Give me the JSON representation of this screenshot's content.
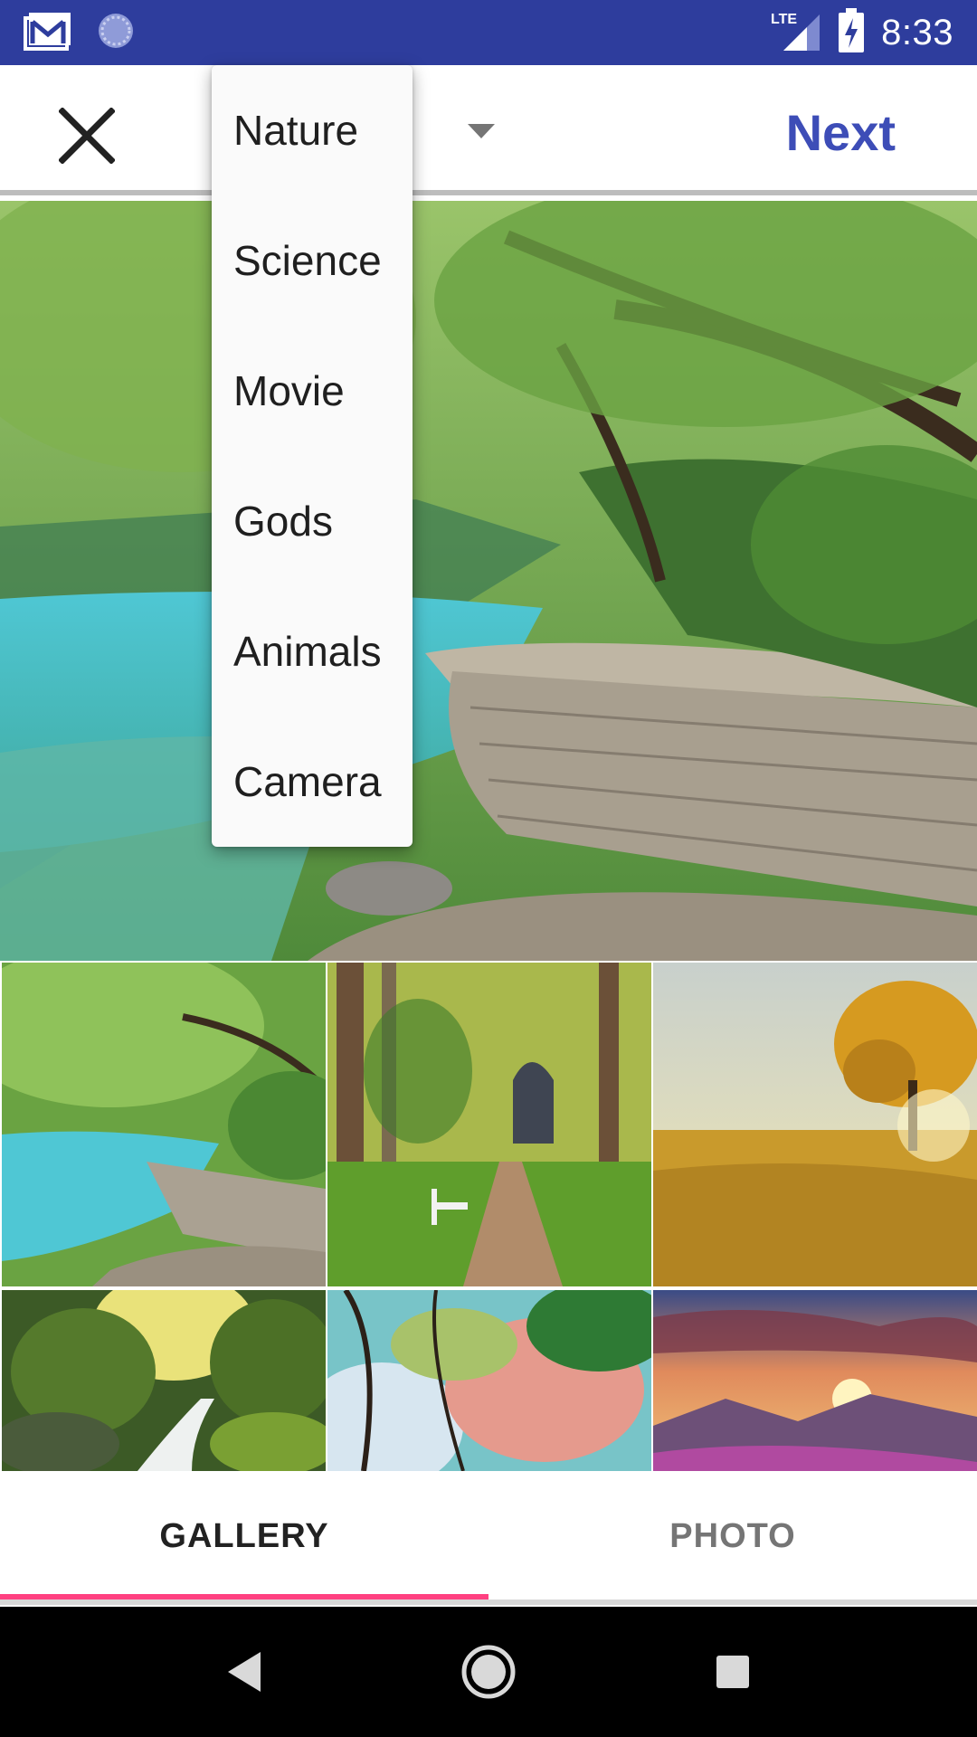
{
  "status_bar": {
    "time": "8:33",
    "network": "LTE",
    "bg_color": "#2e3d9d",
    "icons": [
      "gmail-icon",
      "sync-icon",
      "lte-signal-icon",
      "battery-charging-icon"
    ]
  },
  "app_bar": {
    "close_icon": "close-icon",
    "next_label": "Next",
    "accent_color": "#3d4db7"
  },
  "dropdown": {
    "items": [
      {
        "label": "Nature"
      },
      {
        "label": "Science"
      },
      {
        "label": "Movie"
      },
      {
        "label": "Gods"
      },
      {
        "label": "Animals"
      },
      {
        "label": "Camera"
      }
    ]
  },
  "tabs": [
    {
      "label": "GALLERY",
      "selected": true
    },
    {
      "label": "PHOTO",
      "selected": false
    }
  ],
  "tab_indicator_color": "#ff4081",
  "nav_bar": {
    "icons": [
      "back-icon",
      "home-icon",
      "recents-icon"
    ]
  }
}
